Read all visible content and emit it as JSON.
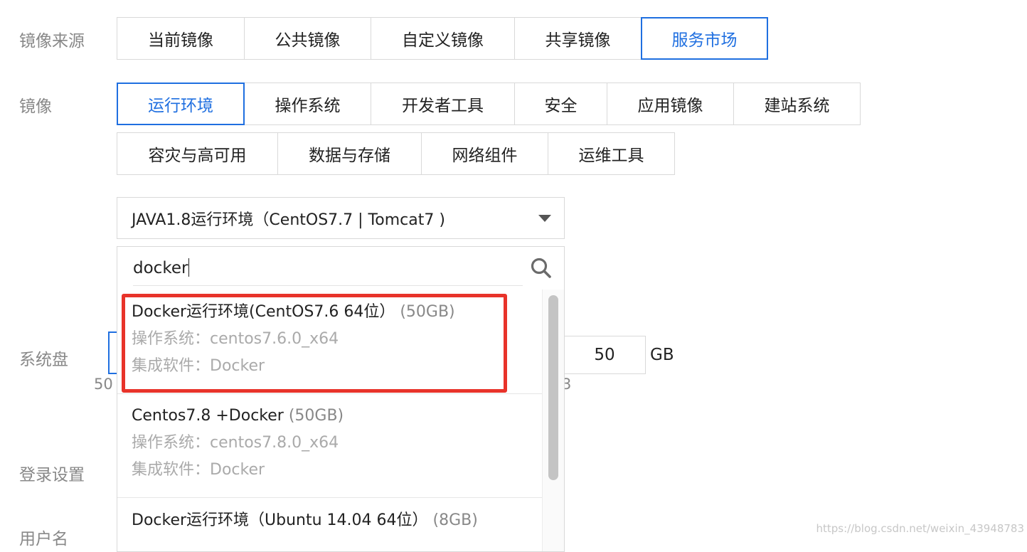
{
  "labels": {
    "image_source": "镜像来源",
    "image": "镜像",
    "system_disk": "系统盘",
    "login_settings": "登录设置",
    "username": "用户名"
  },
  "source_tabs": [
    {
      "label": "当前镜像",
      "active": false
    },
    {
      "label": "公共镜像",
      "active": false
    },
    {
      "label": "自定义镜像",
      "active": false
    },
    {
      "label": "共享镜像",
      "active": false
    },
    {
      "label": "服务市场",
      "active": true
    }
  ],
  "category_tabs_row1": [
    {
      "label": "运行环境",
      "active": true
    },
    {
      "label": "操作系统",
      "active": false
    },
    {
      "label": "开发者工具",
      "active": false
    },
    {
      "label": "安全",
      "active": false
    },
    {
      "label": "应用镜像",
      "active": false
    },
    {
      "label": "建站系统",
      "active": false
    }
  ],
  "category_tabs_row2": [
    {
      "label": "容灾与高可用",
      "active": false
    },
    {
      "label": "数据与存储",
      "active": false
    },
    {
      "label": "网络组件",
      "active": false
    },
    {
      "label": "运维工具",
      "active": false
    }
  ],
  "image_select": {
    "value": "JAVA1.8运行环境（CentOS7.7 | Tomcat7 )"
  },
  "search": {
    "value": "docker"
  },
  "results": [
    {
      "title": "Docker运行环境(CentOS7.6 64位）",
      "size": "(50GB)",
      "os": "操作系统：centos7.6.0_x64",
      "software": "集成软件：Docker"
    },
    {
      "title": "Centos7.8 +Docker ",
      "size": "(50GB)",
      "os": "操作系统：centos7.8.0_x64",
      "software": "集成软件：Docker"
    },
    {
      "title": "Docker运行环境（Ubuntu 14.04 64位）",
      "size": "(8GB)",
      "os": "",
      "software": ""
    }
  ],
  "system_disk": {
    "size_value": "50",
    "unit": "GB",
    "hidden_left_text": "50",
    "hidden_right_text": "3"
  },
  "watermark": "https://blog.csdn.net/weixin_43948783",
  "colors": {
    "accent": "#1f6fe0",
    "highlight": "#e8332a",
    "border": "#d9d9d9",
    "muted_text": "#aaaaaa"
  }
}
